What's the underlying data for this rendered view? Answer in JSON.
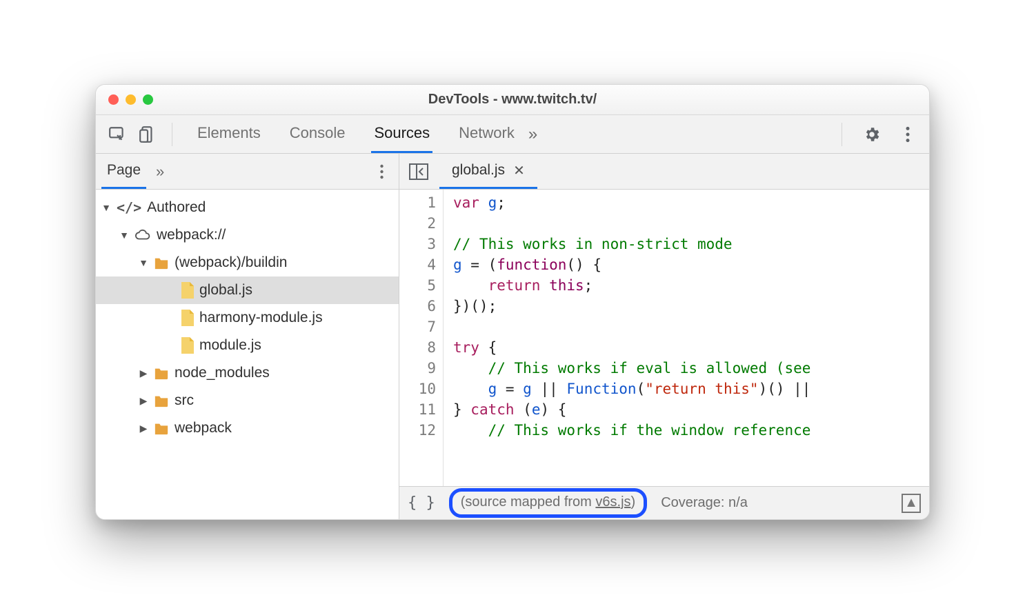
{
  "window": {
    "title": "DevTools - www.twitch.tv/"
  },
  "mainTabs": {
    "items": [
      "Elements",
      "Console",
      "Sources",
      "Network"
    ],
    "activeIndex": 2,
    "overflowGlyph": "»"
  },
  "sidebar": {
    "tabs": {
      "items": [
        "Page"
      ],
      "activeIndex": 0,
      "overflowGlyph": "»"
    },
    "tree": {
      "root": {
        "label": "Authored"
      },
      "domain": {
        "label": "webpack://"
      },
      "buildin": {
        "label": "(webpack)/buildin",
        "files": [
          "global.js",
          "harmony-module.js",
          "module.js"
        ],
        "selectedIndex": 0
      },
      "folders": [
        "node_modules",
        "src",
        "webpack"
      ]
    }
  },
  "editor": {
    "openFile": "global.js",
    "code": {
      "lines": [
        {
          "n": 1,
          "t": [
            [
              "kw",
              "var "
            ],
            [
              "ident",
              "g"
            ],
            [
              "",
              ";"
            ]
          ]
        },
        {
          "n": 2,
          "t": [
            [
              "",
              ""
            ]
          ]
        },
        {
          "n": 3,
          "t": [
            [
              "cmt",
              "// This works in non-strict mode"
            ]
          ]
        },
        {
          "n": 4,
          "t": [
            [
              "ident",
              "g"
            ],
            [
              "",
              " = ("
            ],
            [
              "fn",
              "function"
            ],
            [
              "",
              "() {"
            ]
          ]
        },
        {
          "n": 5,
          "t": [
            [
              "",
              "    "
            ],
            [
              "kw",
              "return "
            ],
            [
              "fn",
              "this"
            ],
            [
              "",
              ";"
            ]
          ]
        },
        {
          "n": 6,
          "t": [
            [
              "",
              "})();"
            ]
          ]
        },
        {
          "n": 7,
          "t": [
            [
              "",
              ""
            ]
          ]
        },
        {
          "n": 8,
          "t": [
            [
              "kw",
              "try"
            ],
            [
              "",
              " {"
            ]
          ]
        },
        {
          "n": 9,
          "t": [
            [
              "",
              "    "
            ],
            [
              "cmt",
              "// This works if eval is allowed (see"
            ]
          ]
        },
        {
          "n": 10,
          "t": [
            [
              "",
              "    "
            ],
            [
              "ident",
              "g"
            ],
            [
              "",
              " = "
            ],
            [
              "ident",
              "g"
            ],
            [
              "",
              " || "
            ],
            [
              "ident",
              "Function"
            ],
            [
              "",
              "("
            ],
            [
              "str",
              "\"return this\""
            ],
            [
              "",
              ")() ||"
            ]
          ]
        },
        {
          "n": 11,
          "t": [
            [
              "",
              "} "
            ],
            [
              "kw",
              "catch"
            ],
            [
              "",
              " ("
            ],
            [
              "ident",
              "e"
            ],
            [
              "",
              ") {"
            ]
          ]
        },
        {
          "n": 12,
          "t": [
            [
              "",
              "    "
            ],
            [
              "cmt",
              "// This works if the window reference"
            ]
          ]
        }
      ]
    },
    "footer": {
      "sourceMappedPrefix": "(source mapped from ",
      "sourceMappedLink": "v6s.js",
      "sourceMappedSuffix": ")",
      "coverageLabel": "Coverage: n/a"
    }
  }
}
